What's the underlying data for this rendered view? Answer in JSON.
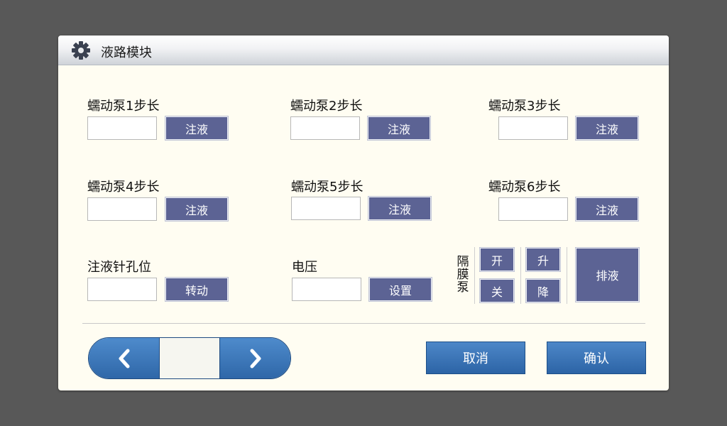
{
  "dialog": {
    "title": "液路模块",
    "title_icon": "gear-icon"
  },
  "pumps": [
    {
      "label": "蠕动泵1步长",
      "value": "",
      "button": "注液"
    },
    {
      "label": "蠕动泵2步长",
      "value": "",
      "button": "注液"
    },
    {
      "label": "蠕动泵3步长",
      "value": "",
      "button": "注液"
    },
    {
      "label": "蠕动泵4步长",
      "value": "",
      "button": "注液"
    },
    {
      "label": "蠕动泵5步长",
      "value": "",
      "button": "注液"
    },
    {
      "label": "蠕动泵6步长",
      "value": "",
      "button": "注液"
    }
  ],
  "needle": {
    "label": "注液针孔位",
    "value": "",
    "button": "转动"
  },
  "voltage": {
    "label": "电压",
    "value": "",
    "button": "设置"
  },
  "diaphragm_pump": {
    "label": "隔膜泵",
    "open": "开",
    "close": "关",
    "up": "升",
    "down": "降",
    "drain": "排液"
  },
  "pager": {
    "prev_icon": "chevron-left-icon",
    "next_icon": "chevron-right-icon"
  },
  "actions": {
    "cancel": "取消",
    "confirm": "确认"
  },
  "colors": {
    "background": "#585858",
    "dialog": "#fffdf2",
    "button": "#5c6394",
    "action_button": "#2f67a8"
  }
}
